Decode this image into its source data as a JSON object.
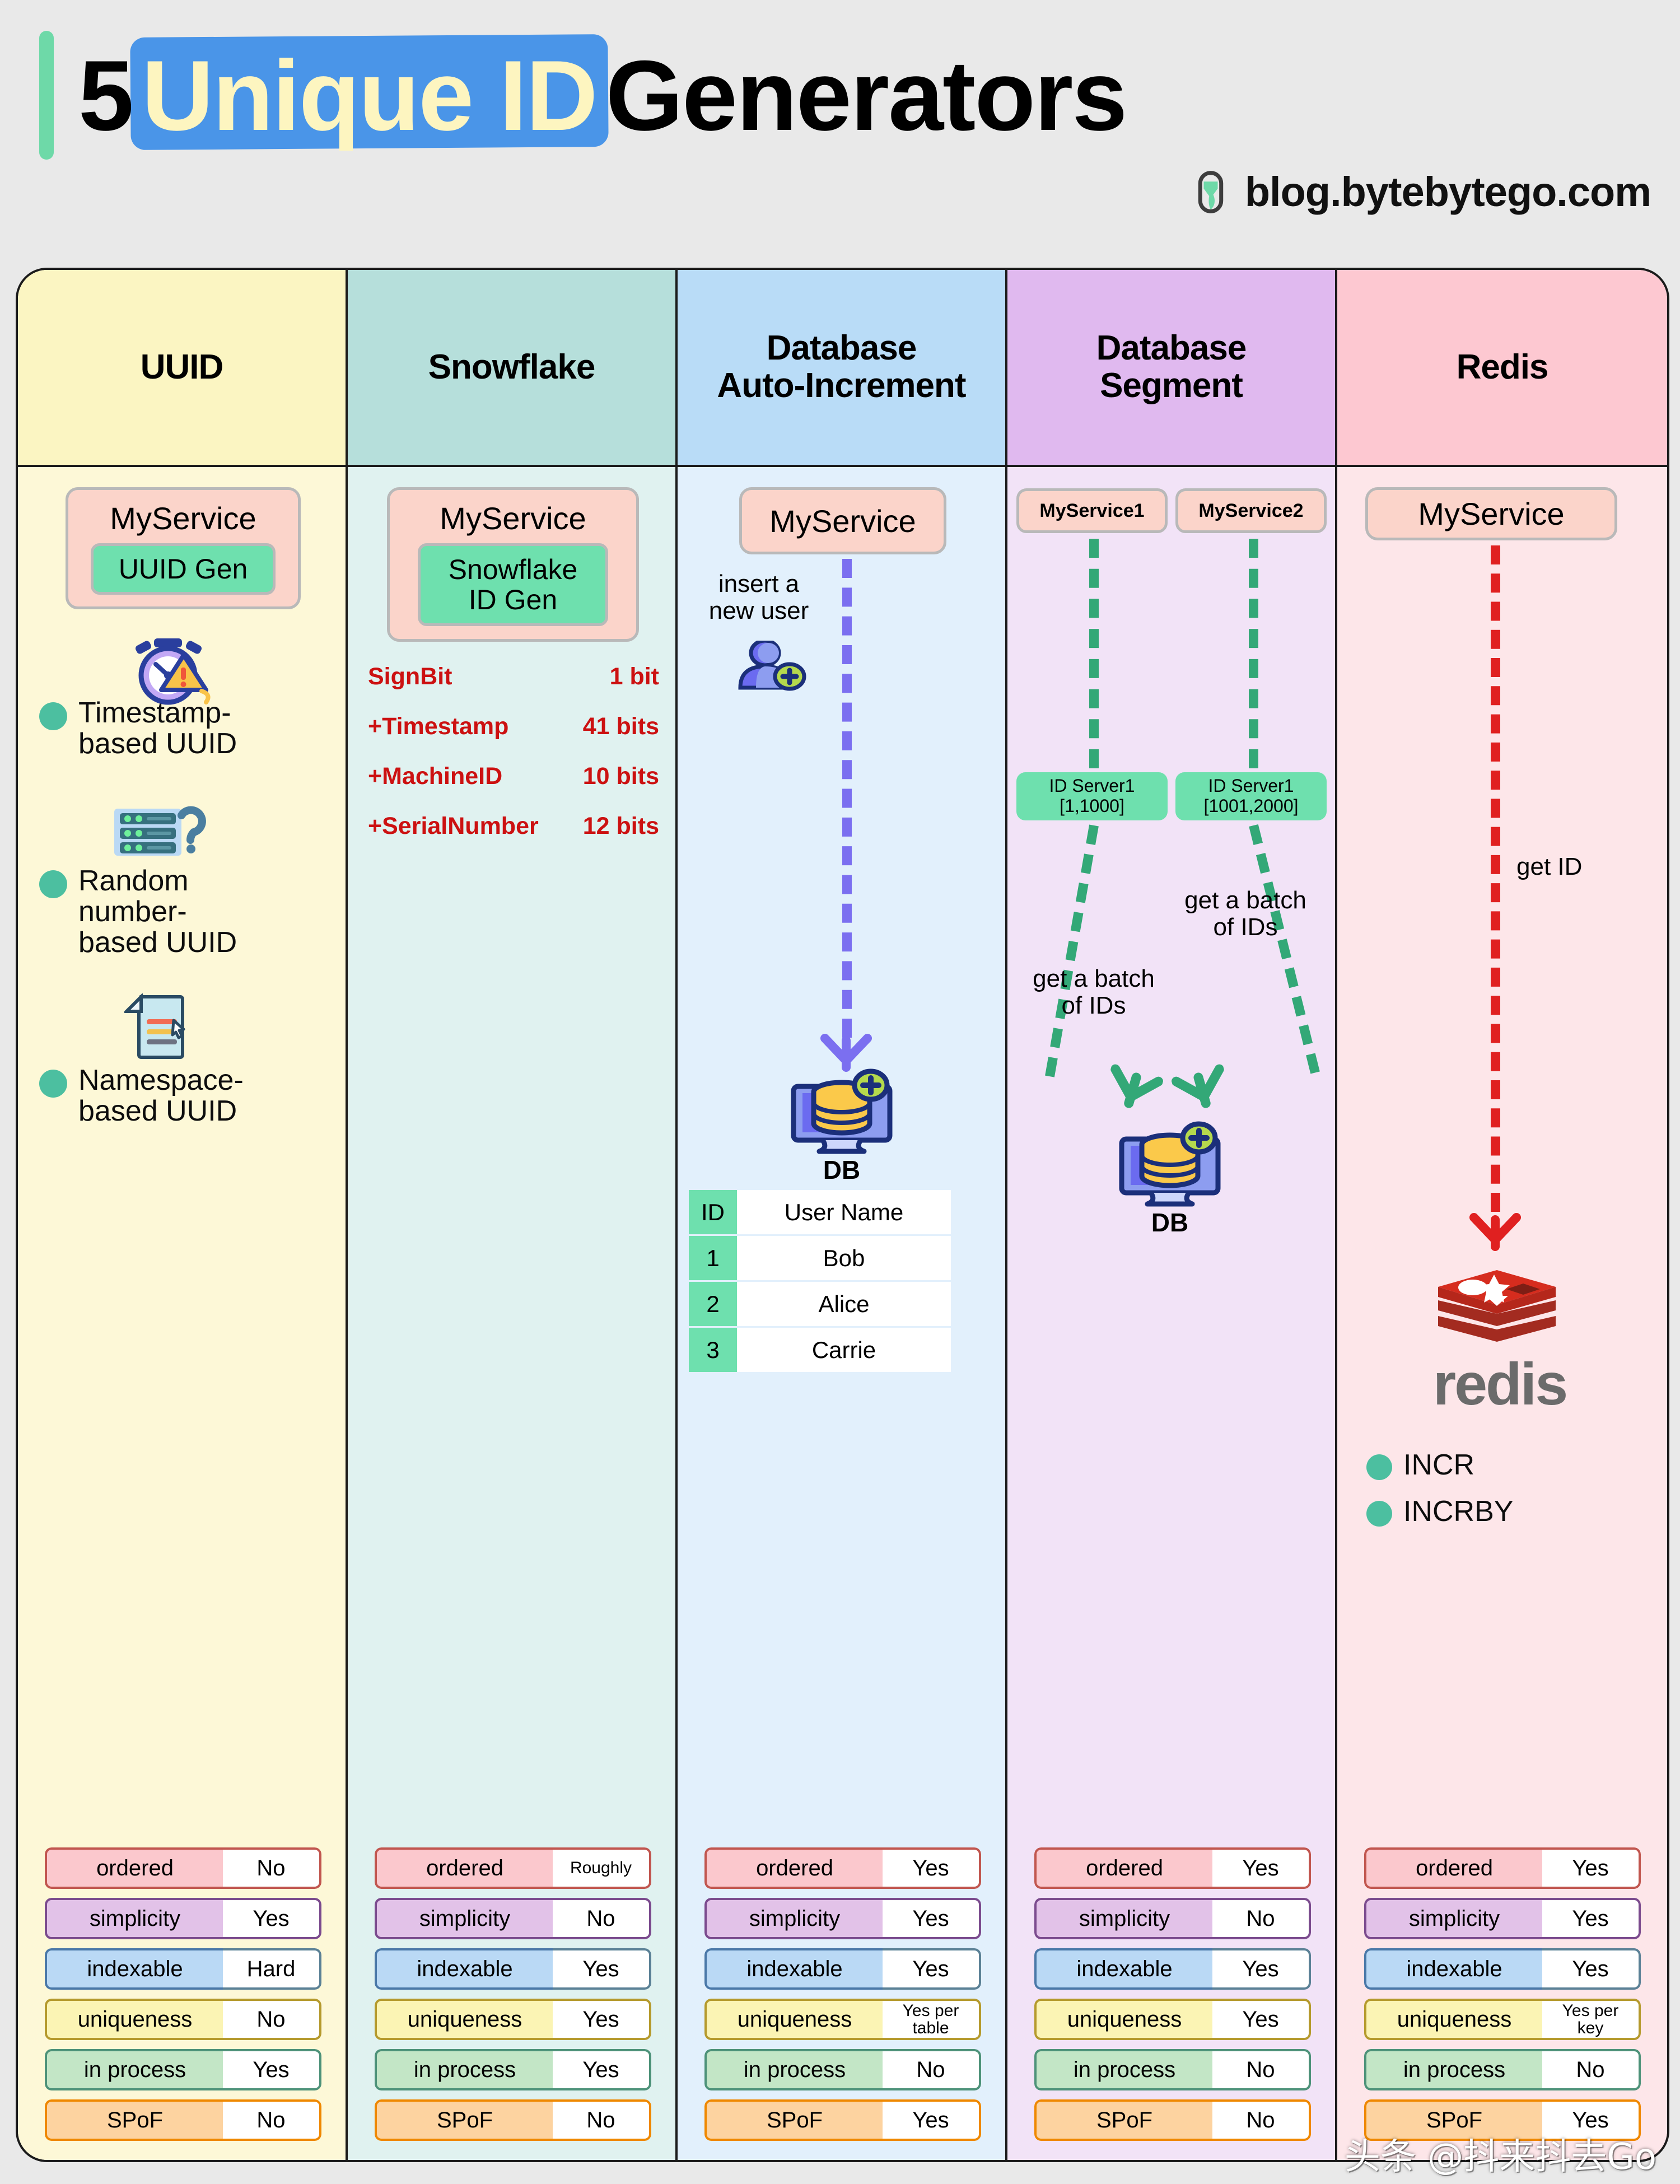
{
  "header": {
    "title_prefix": "5",
    "title_highlight": "Unique ID",
    "title_suffix": "Generators",
    "brand": "blog.bytebytego.com",
    "logo_icon": "bytebytego-logo-icon"
  },
  "watermark": "头条 @抖来抖去Go",
  "colors": {
    "accent_green": "#6ed9a8",
    "highlight_blue": "#4a95e8",
    "highlight_text": "#fdf5c0",
    "uuid_col": "#fdf8d7",
    "snowflake_col": "#e0f2f0",
    "autoinc_col": "#e2f0fc",
    "segment_col": "#f2e3f7",
    "redis_col": "#fde6e9",
    "service_box": "#fbd4ca",
    "gen_box": "#6ee0ae",
    "bullet_dot": "#4cbfa0",
    "bits_red": "#cc1111",
    "arrow_purple": "#7b6ff0",
    "arrow_green": "#33a877",
    "arrow_red": "#e02020"
  },
  "columns": [
    {
      "id": "uuid",
      "title": "UUID",
      "head_bg": "#fbf5c2",
      "body_bg": "#fdf8d7",
      "service": {
        "name": "MyService",
        "generator": "UUID Gen"
      },
      "bullets": [
        {
          "icon": "stopwatch-warning-icon",
          "text": "Timestamp-\nbased UUID"
        },
        {
          "icon": "server-question-icon",
          "text": "Random\nnumber-\nbased UUID"
        },
        {
          "icon": "document-cursor-icon",
          "text": "Namespace-\nbased UUID"
        }
      ],
      "comparison": [
        {
          "key": "ordered",
          "value": "No"
        },
        {
          "key": "simplicity",
          "value": "Yes"
        },
        {
          "key": "indexable",
          "value": "Hard"
        },
        {
          "key": "uniqueness",
          "value": "No"
        },
        {
          "key": "in process",
          "value": "Yes"
        },
        {
          "key": "SPoF",
          "value": "No"
        }
      ]
    },
    {
      "id": "snowflake",
      "title": "Snowflake",
      "head_bg": "#b6dfdb",
      "body_bg": "#e0f2f0",
      "service": {
        "name": "MyService",
        "generator": "Snowflake\nID Gen"
      },
      "bits": [
        {
          "name": "SignBit",
          "value": "1 bit"
        },
        {
          "name": "+Timestamp",
          "value": "41 bits"
        },
        {
          "name": "+MachineID",
          "value": "10 bits"
        },
        {
          "name": "+SerialNumber",
          "value": "12 bits"
        }
      ],
      "comparison": [
        {
          "key": "ordered",
          "value": "Roughly"
        },
        {
          "key": "simplicity",
          "value": "No"
        },
        {
          "key": "indexable",
          "value": "Yes"
        },
        {
          "key": "uniqueness",
          "value": "Yes"
        },
        {
          "key": "in process",
          "value": "Yes"
        },
        {
          "key": "SPoF",
          "value": "No"
        }
      ]
    },
    {
      "id": "db-auto-increment",
      "title": "Database\nAuto-Increment",
      "head_bg": "#b9dcf7",
      "body_bg": "#e2f0fc",
      "service": {
        "name": "MyService"
      },
      "flow_label": "insert a\nnew user",
      "flow_icon": "add-user-icon",
      "db_icon": "database-add-icon",
      "db_label": "DB",
      "table": {
        "headers": [
          "ID",
          "User Name"
        ],
        "rows": [
          [
            "1",
            "Bob"
          ],
          [
            "2",
            "Alice"
          ],
          [
            "3",
            "Carrie"
          ]
        ]
      },
      "comparison": [
        {
          "key": "ordered",
          "value": "Yes"
        },
        {
          "key": "simplicity",
          "value": "Yes"
        },
        {
          "key": "indexable",
          "value": "Yes"
        },
        {
          "key": "uniqueness",
          "value": "Yes per\ntable"
        },
        {
          "key": "in process",
          "value": "No"
        },
        {
          "key": "SPoF",
          "value": "Yes"
        }
      ]
    },
    {
      "id": "db-segment",
      "title": "Database\nSegment",
      "head_bg": "#e0b9ef",
      "body_bg": "#f2e3f7",
      "services": [
        "MyService1",
        "MyService2"
      ],
      "id_servers": [
        "ID Server1\n[1,1000]",
        "ID Server1\n[1001,2000]"
      ],
      "batch_labels": [
        "get a batch\nof IDs",
        "get a batch\nof IDs"
      ],
      "db_icon": "database-add-icon",
      "db_label": "DB",
      "comparison": [
        {
          "key": "ordered",
          "value": "Yes"
        },
        {
          "key": "simplicity",
          "value": "No"
        },
        {
          "key": "indexable",
          "value": "Yes"
        },
        {
          "key": "uniqueness",
          "value": "Yes"
        },
        {
          "key": "in process",
          "value": "No"
        },
        {
          "key": "SPoF",
          "value": "No"
        }
      ]
    },
    {
      "id": "redis",
      "title": "Redis",
      "head_bg": "#fdc8d1",
      "body_bg": "#fde6e9",
      "service": {
        "name": "MyService"
      },
      "flow_label": "get ID",
      "redis_icon": "redis-logo-icon",
      "redis_wordmark": "redis",
      "bullets": [
        {
          "text": "INCR"
        },
        {
          "text": "INCRBY"
        }
      ],
      "comparison": [
        {
          "key": "ordered",
          "value": "Yes"
        },
        {
          "key": "simplicity",
          "value": "Yes"
        },
        {
          "key": "indexable",
          "value": "Yes"
        },
        {
          "key": "uniqueness",
          "value": "Yes per\nkey"
        },
        {
          "key": "in process",
          "value": "No"
        },
        {
          "key": "SPoF",
          "value": "Yes"
        }
      ]
    }
  ]
}
